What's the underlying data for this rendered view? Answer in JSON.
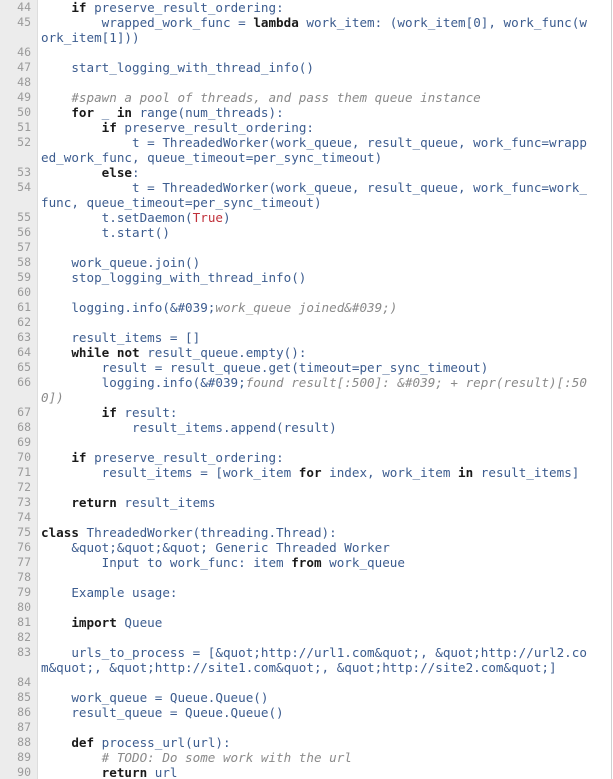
{
  "editor": {
    "lines": [
      {
        "n": "44",
        "text": "    if preserve_result_ordering:"
      },
      {
        "n": "45",
        "text": "        wrapped_work_func = lambda work_item: (work_item[0], work_func(w"
      },
      {
        "n": "",
        "text": "ork_item[1]))"
      },
      {
        "n": "46",
        "text": ""
      },
      {
        "n": "47",
        "text": "    start_logging_with_thread_info()"
      },
      {
        "n": "48",
        "text": ""
      },
      {
        "n": "49",
        "text": "    #spawn a pool of threads, and pass them queue instance"
      },
      {
        "n": "50",
        "text": "    for _ in range(num_threads):"
      },
      {
        "n": "51",
        "text": "        if preserve_result_ordering:"
      },
      {
        "n": "52",
        "text": "            t = ThreadedWorker(work_queue, result_queue, work_func=wrapp"
      },
      {
        "n": "",
        "text": "ed_work_func, queue_timeout=per_sync_timeout)"
      },
      {
        "n": "53",
        "text": "        else:"
      },
      {
        "n": "54",
        "text": "            t = ThreadedWorker(work_queue, result_queue, work_func=work_"
      },
      {
        "n": "",
        "text": "func, queue_timeout=per_sync_timeout)"
      },
      {
        "n": "55",
        "text": "        t.setDaemon(True)"
      },
      {
        "n": "56",
        "text": "        t.start()"
      },
      {
        "n": "57",
        "text": ""
      },
      {
        "n": "58",
        "text": "    work_queue.join()"
      },
      {
        "n": "59",
        "text": "    stop_logging_with_thread_info()"
      },
      {
        "n": "60",
        "text": ""
      },
      {
        "n": "61",
        "text": "    logging.info(&#039;work_queue joined&#039;)"
      },
      {
        "n": "62",
        "text": ""
      },
      {
        "n": "63",
        "text": "    result_items = []"
      },
      {
        "n": "64",
        "text": "    while not result_queue.empty():"
      },
      {
        "n": "65",
        "text": "        result = result_queue.get(timeout=per_sync_timeout)"
      },
      {
        "n": "66",
        "text": "        logging.info(&#039;found result[:500]: &#039; + repr(result)[:50"
      },
      {
        "n": "",
        "text": "0])"
      },
      {
        "n": "67",
        "text": "        if result:"
      },
      {
        "n": "68",
        "text": "            result_items.append(result)"
      },
      {
        "n": "69",
        "text": ""
      },
      {
        "n": "70",
        "text": "    if preserve_result_ordering:"
      },
      {
        "n": "71",
        "text": "        result_items = [work_item for index, work_item in result_items]"
      },
      {
        "n": "72",
        "text": ""
      },
      {
        "n": "73",
        "text": "    return result_items"
      },
      {
        "n": "74",
        "text": ""
      },
      {
        "n": "75",
        "text": "class ThreadedWorker(threading.Thread):"
      },
      {
        "n": "76",
        "text": "    &quot;&quot;&quot; Generic Threaded Worker"
      },
      {
        "n": "77",
        "text": "        Input to work_func: item from work_queue"
      },
      {
        "n": "78",
        "text": ""
      },
      {
        "n": "79",
        "text": "    Example usage:"
      },
      {
        "n": "80",
        "text": ""
      },
      {
        "n": "81",
        "text": "    import Queue"
      },
      {
        "n": "82",
        "text": ""
      },
      {
        "n": "83",
        "text": "    urls_to_process = [&quot;http://url1.com&quot;, &quot;http://url2.co"
      },
      {
        "n": "",
        "text": "m&quot;, &quot;http://site1.com&quot;, &quot;http://site2.com&quot;]"
      },
      {
        "n": "84",
        "text": ""
      },
      {
        "n": "85",
        "text": "    work_queue = Queue.Queue()"
      },
      {
        "n": "86",
        "text": "    result_queue = Queue.Queue()"
      },
      {
        "n": "87",
        "text": ""
      },
      {
        "n": "88",
        "text": "    def process_url(url):"
      },
      {
        "n": "89",
        "text": "        # TODO: Do some work with the url"
      },
      {
        "n": "90",
        "text": "        return url"
      }
    ]
  }
}
